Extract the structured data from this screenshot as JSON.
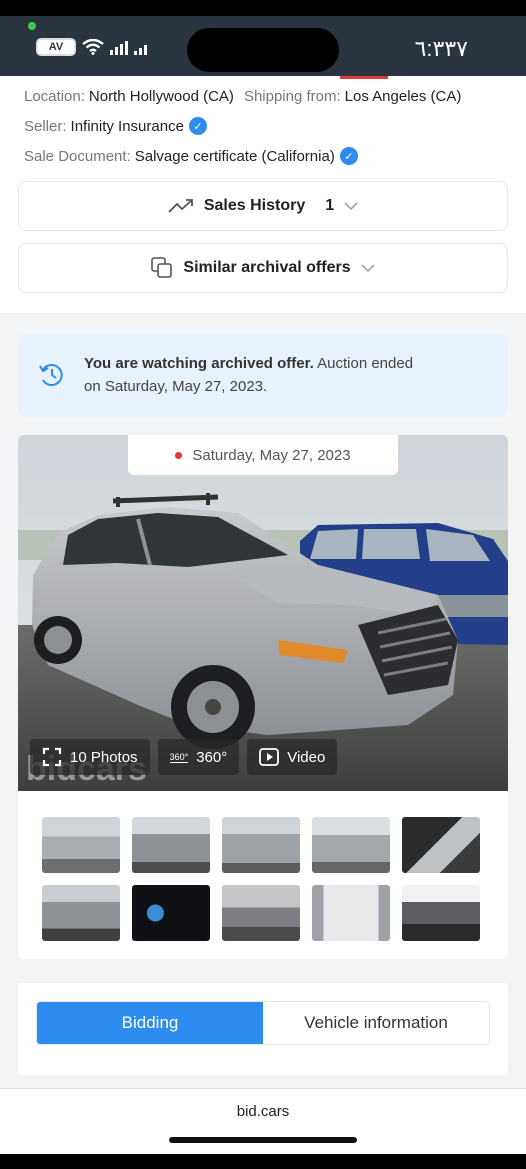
{
  "status_bar": {
    "time": "٦:٣٣٧",
    "battery": "AV",
    "colors": {
      "bar": "#2b3540",
      "dot": "#3ccf4e"
    }
  },
  "details": {
    "location_label": "Location:",
    "location_value": "North Hollywood (CA)",
    "shipping_label": "Shipping from:",
    "shipping_value": "Los Angeles (CA)",
    "seller_label": "Seller:",
    "seller_value": "Infinity Insurance",
    "sale_doc_label": "Sale Document:",
    "sale_doc_value": "Salvage certificate (California)"
  },
  "accordions": {
    "sales_history_label": "Sales History",
    "sales_history_count": "1",
    "similar_offers_label": "Similar archival offers"
  },
  "archived_notice": {
    "bold": "You are watching archived offer.",
    "rest": " Auction ended",
    "line2": "on Saturday, May 27, 2023."
  },
  "gallery": {
    "date": "Saturday, May 27, 2023",
    "photos_label": "10 Photos",
    "view360_badge": "360°",
    "view360_label": "360°",
    "video_label": "Video",
    "watermark": "bidcars",
    "thumbnails": [
      "front-left",
      "front-damage",
      "rear",
      "rear-right",
      "interior",
      "front-left-damage",
      "dashboard",
      "rear-seats",
      "label-sticker",
      "engine"
    ]
  },
  "tabs": {
    "bidding": "Bidding",
    "vehicle_info": "Vehicle information",
    "accent": "#2e8cf0"
  },
  "browser": {
    "url": "bid.cars"
  }
}
